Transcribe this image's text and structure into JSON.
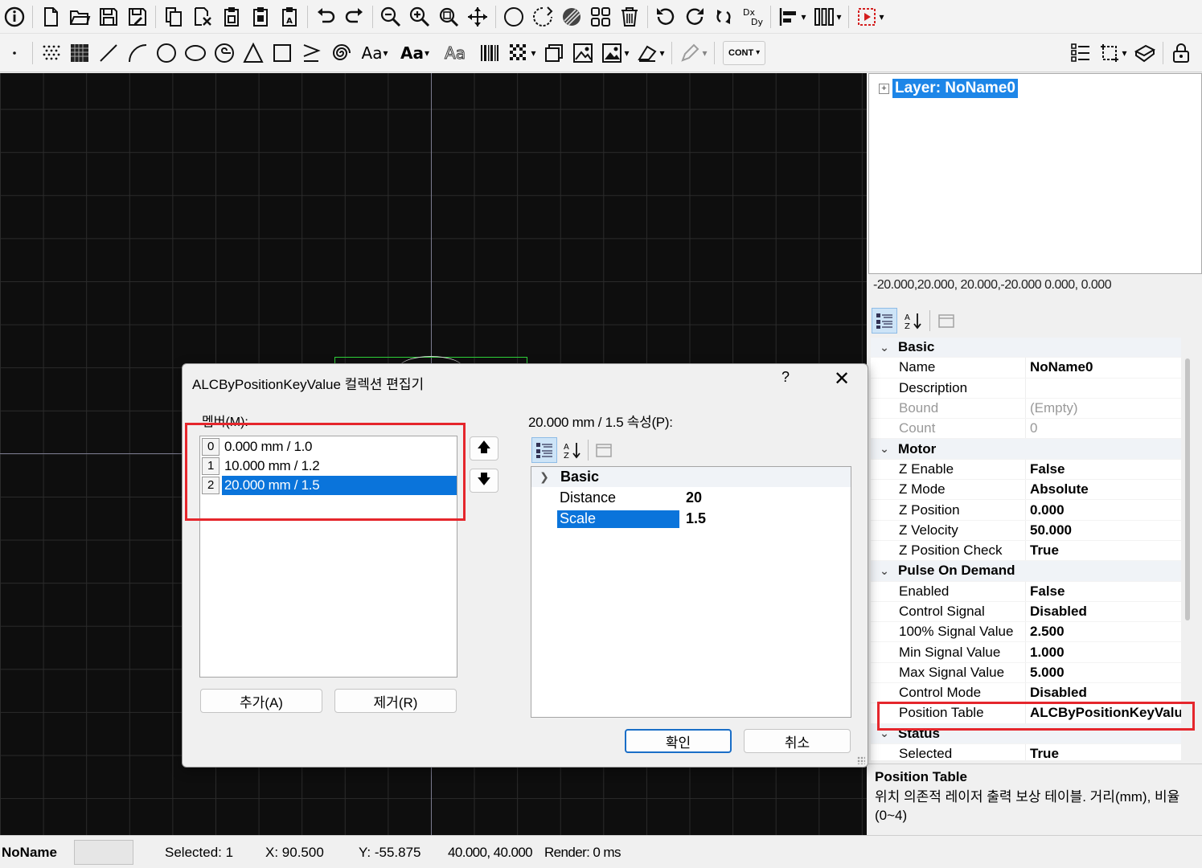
{
  "toolbar_row1": {
    "icons": [
      "info-icon",
      "new-file-icon",
      "open-folder-icon",
      "save-icon",
      "save-as-icon",
      "copy-icon",
      "cut-icon",
      "paste-icon",
      "paste-special-icon",
      "paste-text-icon",
      "undo-icon",
      "redo-icon",
      "zoom-out-icon",
      "zoom-in-icon",
      "zoom-window-icon",
      "pan-icon",
      "circle-select-icon",
      "lasso-icon",
      "hatch-icon",
      "group-icon",
      "delete-icon",
      "rotate-ccw-icon",
      "rotate-cw-icon",
      "mirror-icon",
      "scale-icon",
      "align-icon",
      "distribute-icon",
      "run-icon"
    ],
    "scale_label_dx": "Dx",
    "scale_label_dy": "Dy"
  },
  "toolbar_row2": {
    "aa_label": "Aa",
    "cont_label": "CONT"
  },
  "tree": {
    "expander": "+",
    "layer_label": "Layer: NoName0"
  },
  "bounds_text": "-20.000,20.000, 20.000,-20.000    0.000, 0.000",
  "properties": [
    {
      "type": "category",
      "label": "Basic"
    },
    {
      "name": "Name",
      "value": "NoName0"
    },
    {
      "name": "Description",
      "value": ""
    },
    {
      "name": "Bound",
      "value": "(Empty)",
      "style": "gray"
    },
    {
      "name": "Count",
      "value": "0",
      "style": "gray"
    },
    {
      "type": "category",
      "label": "Motor"
    },
    {
      "name": "Z Enable",
      "value": "False"
    },
    {
      "name": "Z Mode",
      "value": "Absolute"
    },
    {
      "name": "Z Position",
      "value": "0.000"
    },
    {
      "name": "Z Velocity",
      "value": "50.000"
    },
    {
      "name": "Z Position Check",
      "value": "True"
    },
    {
      "type": "category",
      "label": "Pulse On Demand"
    },
    {
      "name": "Enabled",
      "value": "False"
    },
    {
      "name": "Control Signal",
      "value": "Disabled"
    },
    {
      "name": "100% Signal Value",
      "value": "2.500"
    },
    {
      "name": "Min Signal Value",
      "value": "1.000"
    },
    {
      "name": "Max Signal Value",
      "value": "5.000"
    },
    {
      "name": "Control Mode",
      "value": "Disabled"
    },
    {
      "name": "Position Table",
      "value": "ALCByPositionKeyValu"
    },
    {
      "type": "category",
      "label": "Status"
    },
    {
      "name": "Selected",
      "value": "True"
    }
  ],
  "description": {
    "title": "Position Table",
    "text": "위치 의존적 레이저 출력 보상 테이블. 거리(mm), 비율(0~4)"
  },
  "statusbar": {
    "name": "NoName",
    "selected": "Selected: 1",
    "x": "X: 90.500",
    "y": "Y: -55.875",
    "size": "40.000, 40.000",
    "render": "Render: 0 ms"
  },
  "dialog": {
    "title": "ALCByPositionKeyValue 컬렉션 편집기",
    "help": "?",
    "close": "✕",
    "members_label": "멤버(M):",
    "members": [
      {
        "index": "0",
        "text": "0.000 mm / 1.0",
        "selected": false
      },
      {
        "index": "1",
        "text": "10.000 mm / 1.2",
        "selected": false
      },
      {
        "index": "2",
        "text": "20.000 mm / 1.5",
        "selected": true
      }
    ],
    "up_arrow": "🡅",
    "down_arrow": "🡇",
    "add_label": "추가(A)",
    "remove_label": "제거(R)",
    "props_label": "20.000 mm / 1.5 속성(P):",
    "props": {
      "category": "Basic",
      "rows": [
        {
          "name": "Distance",
          "value": "20",
          "selected": false
        },
        {
          "name": "Scale",
          "value": "1.5",
          "selected": true
        }
      ]
    },
    "ok_label": "확인",
    "cancel_label": "취소"
  },
  "colors": {
    "highlight_frame": "#e5262c",
    "selection": "#0a74db",
    "layer_selection": "#1d86e8",
    "canvas_bg": "#0e0e0e",
    "object_outline": "#2fd43a"
  }
}
